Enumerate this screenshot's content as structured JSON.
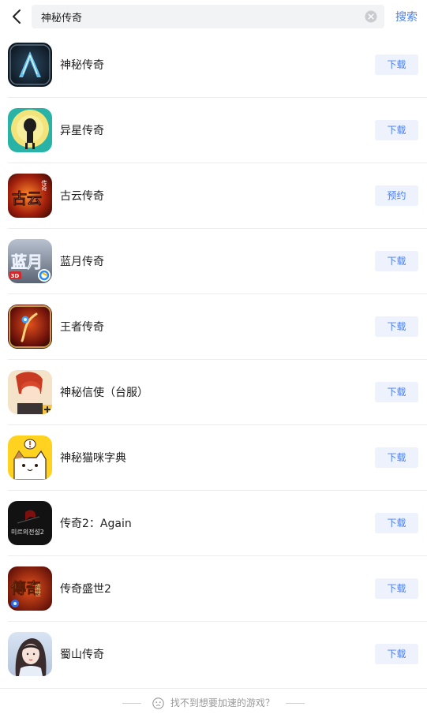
{
  "search": {
    "value": "神秘传奇",
    "submit_label": "搜索"
  },
  "results": [
    {
      "name": "神秘传奇",
      "action": "下载",
      "icon": "mystic-legend-icon"
    },
    {
      "name": "异星传奇",
      "action": "下载",
      "icon": "alien-legend-icon"
    },
    {
      "name": "古云传奇",
      "action": "预约",
      "icon": "guyun-legend-icon",
      "icon_text": "古云",
      "icon_badge": "传奇"
    },
    {
      "name": "蓝月传奇",
      "action": "下载",
      "icon": "blue-moon-legend-icon",
      "icon_text": "蓝月",
      "icon_badge": "3D"
    },
    {
      "name": "王者传奇",
      "action": "下载",
      "icon": "king-legend-icon"
    },
    {
      "name": "神秘信使（台服）",
      "action": "下载",
      "icon": "mystic-messenger-icon"
    },
    {
      "name": "神秘猫咪字典",
      "action": "下载",
      "icon": "cat-dictionary-icon"
    },
    {
      "name": "传奇2：Again",
      "action": "下载",
      "icon": "legend2-again-icon",
      "icon_text": "미르의전설2"
    },
    {
      "name": "传奇盛世2",
      "action": "下载",
      "icon": "legend-shengshi2-icon",
      "icon_text": "傳奇",
      "icon_badge": "盛世"
    },
    {
      "name": "蜀山传奇",
      "action": "下载",
      "icon": "shushan-legend-icon"
    }
  ],
  "footer": {
    "text": "找不到想要加速的游戏？"
  },
  "colors": {
    "accent": "#4a7ff0",
    "button_bg": "#eef2fc",
    "search_bg": "#f2f3f5"
  }
}
